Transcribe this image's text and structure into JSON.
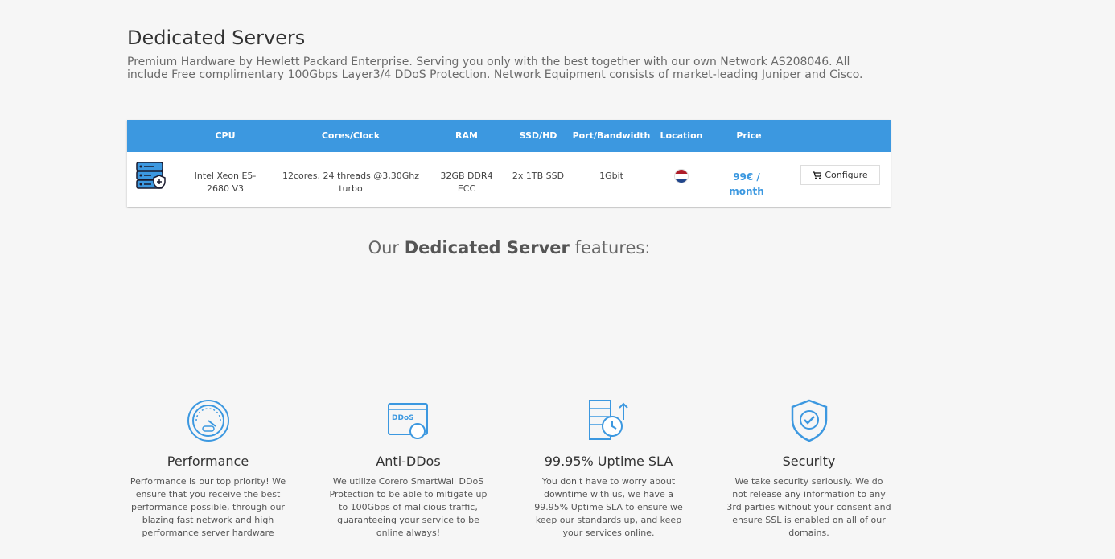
{
  "page": {
    "title": "Dedicated Servers",
    "subtitle": "Premium Hardware by Hewlett Packard Enterprise. Serving you only with the best together with our own Network AS208046. All include Free complimentary 100Gbps Layer3/4 DDoS Protection. Network Equipment consists of market-leading Juniper and Cisco."
  },
  "table": {
    "headers": [
      "CPU",
      "Cores/Clock",
      "RAM",
      "SSD/HD",
      "Port/Bandwidth",
      "Location",
      "Price"
    ],
    "rows": [
      {
        "cpu": "Intel Xeon E5-2680 V3",
        "cores": "12cores, 24 threads @3,30Ghz turbo",
        "ram": "32GB DDR4 ECC",
        "disk": "2x 1TB SSD",
        "port": "1Gbit",
        "location": "Netherlands flag",
        "price": "99€ / month",
        "button": "Configure"
      }
    ]
  },
  "features": {
    "title_prefix": "Our",
    "title_bold": "Dedicated Server",
    "title_suffix": "features:",
    "items": [
      {
        "icon": "speedometer-icon",
        "title": "Performance",
        "text": "Performance is our top priority! We ensure that you receive the best performance possible, through our blazing fast network and high performance server hardware"
      },
      {
        "icon": "ddos-icon",
        "title": "Anti-DDos",
        "text": "We utilize Corero SmartWall DDoS Protection to be able to mitigate up to 100Gbps of malicious traffic, guaranteeing your service to be online always!"
      },
      {
        "icon": "uptime-icon",
        "title": "99.95% Uptime SLA",
        "text": "You don't have to worry about downtime with us, we have a 99.95% Uptime SLA to ensure we keep our standards up, and keep your services online."
      },
      {
        "icon": "shield-check-icon",
        "title": "Security",
        "text": "We take security seriously. We do not release any information to any 3rd parties without your consent and ensure SSL is enabled on all of our domains."
      }
    ]
  },
  "colors": {
    "accent": "#3c98e0",
    "background": "#f6f6f6"
  }
}
